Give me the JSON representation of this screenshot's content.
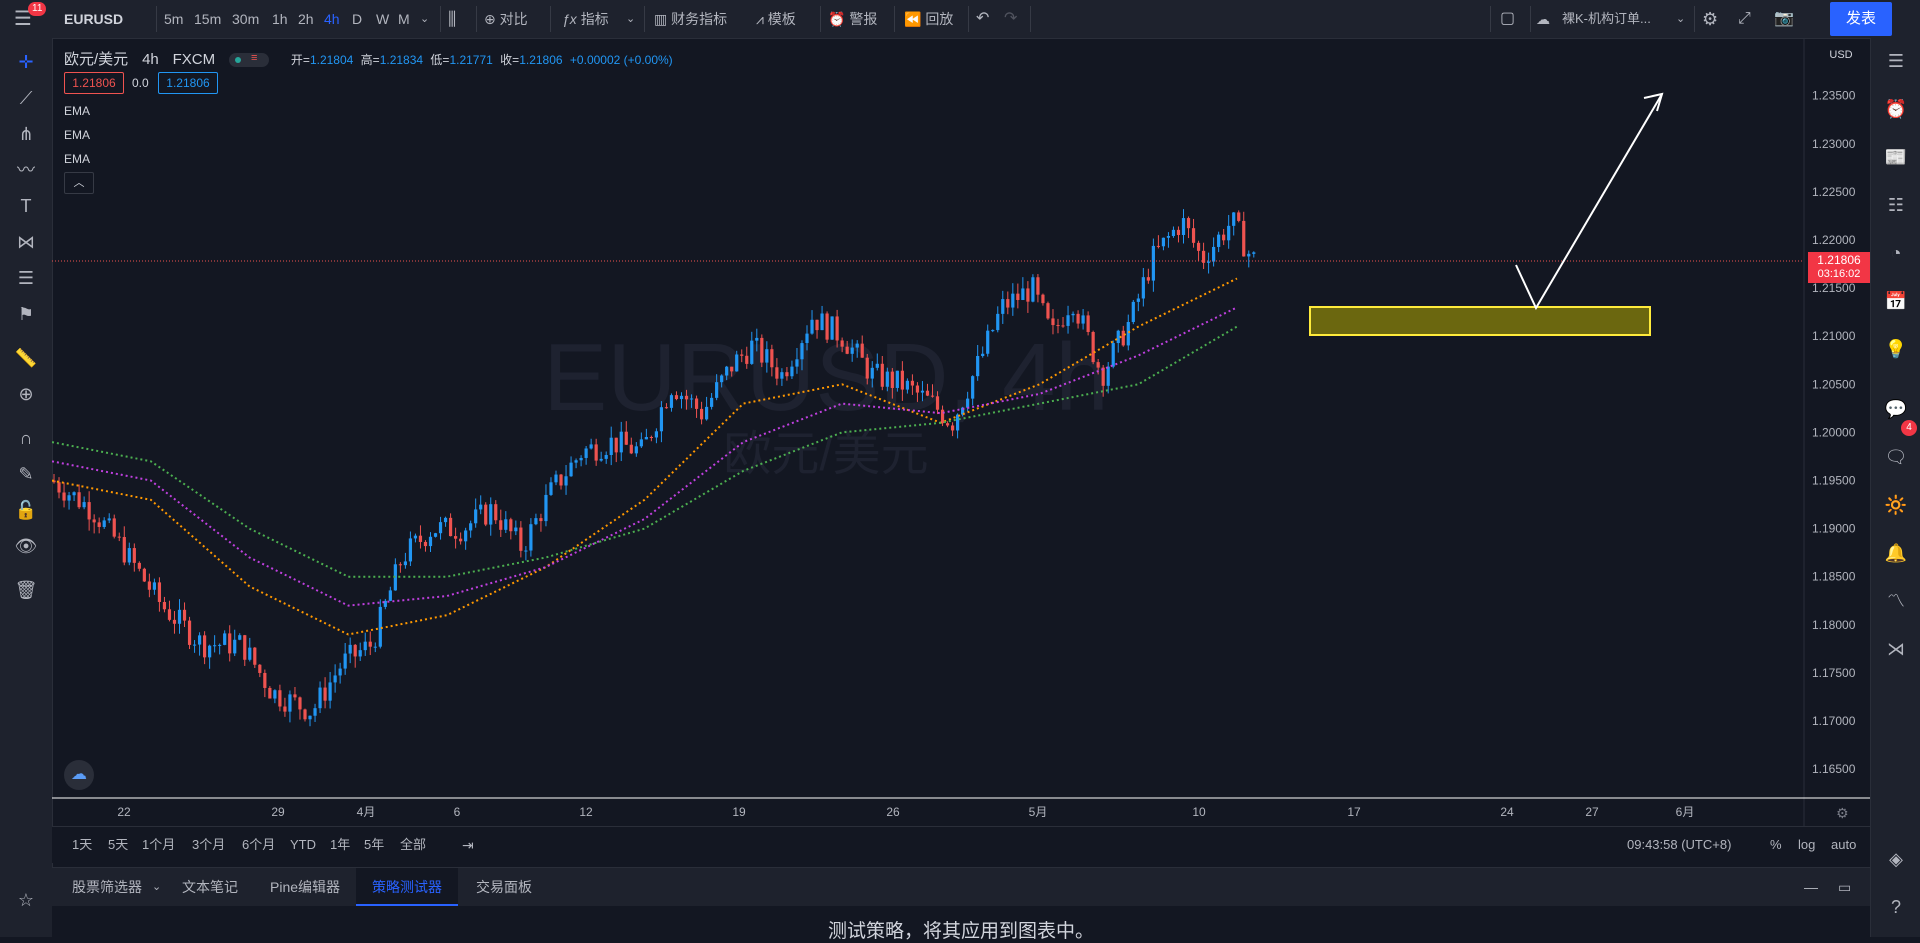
{
  "header": {
    "menu_badge": "11",
    "symbol": "EURUSD",
    "intervals": [
      "5m",
      "15m",
      "30m",
      "1h",
      "2h",
      "4h",
      "D",
      "W",
      "M"
    ],
    "active_interval": "4h",
    "compare_label": "对比",
    "indicators_label": "指标",
    "financials_label": "财务指标",
    "templates_label": "模板",
    "alert_label": "警报",
    "replay_label": "回放",
    "layout_name": "裸K-机构订单...",
    "publish_label": "发表"
  },
  "legend": {
    "title": "欧元/美元",
    "interval": "4h",
    "exchange": "FXCM",
    "open_label": "开=",
    "open": "1.21804",
    "high_label": "高=",
    "high": "1.21834",
    "low_label": "低=",
    "low": "1.21771",
    "close_label": "收=",
    "close": "1.21806",
    "change": "+0.00002 (+0.00%)",
    "bid": "1.21806",
    "spread": "0.0",
    "ask": "1.21806",
    "indicators": [
      "EMA",
      "EMA",
      "EMA"
    ]
  },
  "watermark": {
    "line1": "EURUSD, 4h",
    "line2": "欧元/美元"
  },
  "price_axis": {
    "currency": "USD",
    "labels": [
      "1.23500",
      "1.23000",
      "1.22500",
      "1.22000",
      "1.21500",
      "1.21000",
      "1.20500",
      "1.20000",
      "1.19500",
      "1.19000",
      "1.18500",
      "1.18000",
      "1.17500",
      "1.17000",
      "1.16500"
    ],
    "current_price": "1.21806",
    "countdown": "03:16:02"
  },
  "time_axis": {
    "labels": [
      "22",
      "29",
      "4月",
      "6",
      "12",
      "19",
      "26",
      "5月",
      "10",
      "17",
      "24",
      "27",
      "6月"
    ]
  },
  "range_bar": {
    "ranges": [
      "1天",
      "5天",
      "1个月",
      "3个月",
      "6个月",
      "YTD",
      "1年",
      "5年",
      "全部"
    ],
    "clock": "09:43:58 (UTC+8)",
    "pct": "%",
    "log": "log",
    "auto": "auto"
  },
  "bottom_tabs": {
    "tabs": [
      "股票筛选器",
      "文本笔记",
      "Pine编辑器",
      "策略测试器",
      "交易面板"
    ],
    "active": "策略测试器",
    "message": "测试策略，将其应用到图表中。"
  },
  "right_badge": "4",
  "colors": {
    "up": "#2196f3",
    "down": "#ef5350",
    "ema_fast": "#ff9800",
    "ema_mid": "#c040e0",
    "ema_slow": "#4caf50",
    "zone": "#ffeb3b",
    "accent": "#2962ff"
  },
  "chart_data": {
    "type": "candlestick",
    "symbol": "EURUSD",
    "timeframe": "4h",
    "ylim": [
      1.162,
      1.241
    ],
    "series": [
      {
        "name": "EMA",
        "values": [
          1.195,
          1.193,
          1.184,
          1.179,
          1.181,
          1.186,
          1.193,
          1.203,
          1.205,
          1.201,
          1.205,
          1.211,
          1.216
        ]
      },
      {
        "name": "EMA",
        "values": [
          1.197,
          1.195,
          1.187,
          1.182,
          1.183,
          1.186,
          1.191,
          1.199,
          1.203,
          1.202,
          1.204,
          1.208,
          1.213
        ]
      },
      {
        "name": "EMA",
        "values": [
          1.199,
          1.197,
          1.19,
          1.185,
          1.185,
          1.187,
          1.19,
          1.196,
          1.2,
          1.201,
          1.203,
          1.205,
          1.211
        ]
      }
    ]
  }
}
